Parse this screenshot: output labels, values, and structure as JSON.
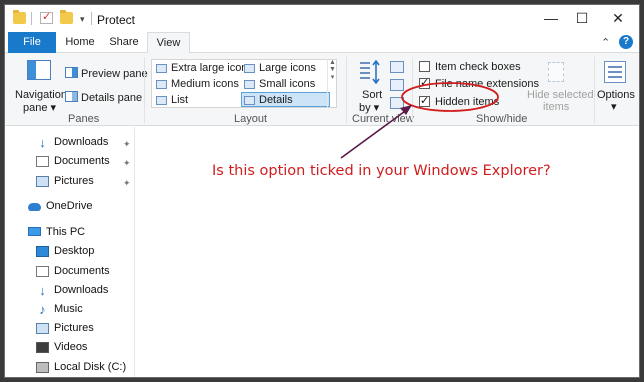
{
  "window": {
    "title": "Protect",
    "minimize": "—",
    "maximize": "☐",
    "close": "✕"
  },
  "ribbon_tabs": {
    "file": "File",
    "home": "Home",
    "share": "Share",
    "view": "View"
  },
  "panes_group": {
    "navigation_pane_line1": "Navigation",
    "navigation_pane_line2": "pane ▾",
    "preview_pane": "Preview pane",
    "details_pane": "Details pane",
    "label": "Panes"
  },
  "layout_group": {
    "items": [
      {
        "label": "Extra large icons"
      },
      {
        "label": "Large icons"
      },
      {
        "label": "Medium icons"
      },
      {
        "label": "Small icons"
      },
      {
        "label": "List"
      },
      {
        "label": "Details",
        "selected": true
      }
    ],
    "label": "Layout"
  },
  "current_view_group": {
    "sort_line1": "Sort",
    "sort_line2": "by ▾",
    "label": "Current view"
  },
  "show_hide_group": {
    "item_check_boxes": {
      "label": "Item check boxes",
      "checked": false
    },
    "file_name_extensions": {
      "label": "File name extensions",
      "checked": true
    },
    "hidden_items": {
      "label": "Hidden items",
      "checked": true
    },
    "hide_selected_line1": "Hide selected",
    "hide_selected_line2": "items",
    "label": "Show/hide"
  },
  "options": {
    "label": "Options",
    "arrow": "▾"
  },
  "navigation": {
    "items": [
      {
        "label": "Downloads",
        "icon": "downloads-icon",
        "pinned": true
      },
      {
        "label": "Documents",
        "icon": "documents-icon",
        "pinned": true
      },
      {
        "label": "Pictures",
        "icon": "pictures-icon",
        "pinned": true
      },
      {
        "label": "OneDrive",
        "icon": "onedrive-icon"
      },
      {
        "label": "This PC",
        "icon": "this-pc-icon"
      },
      {
        "label": "Desktop",
        "icon": "desktop-icon"
      },
      {
        "label": "Documents",
        "icon": "documents-icon"
      },
      {
        "label": "Downloads",
        "icon": "downloads-icon"
      },
      {
        "label": "Music",
        "icon": "music-icon"
      },
      {
        "label": "Pictures",
        "icon": "pictures-icon"
      },
      {
        "label": "Videos",
        "icon": "videos-icon"
      },
      {
        "label": "Local Disk (C:)",
        "icon": "local-disk-icon"
      }
    ]
  },
  "annotation": {
    "text": "Is this option ticked in your Windows Explorer?",
    "color": "#d01e1e"
  },
  "colors": {
    "accent": "#1979ca",
    "ribbon_bg": "#f5f6f7"
  }
}
